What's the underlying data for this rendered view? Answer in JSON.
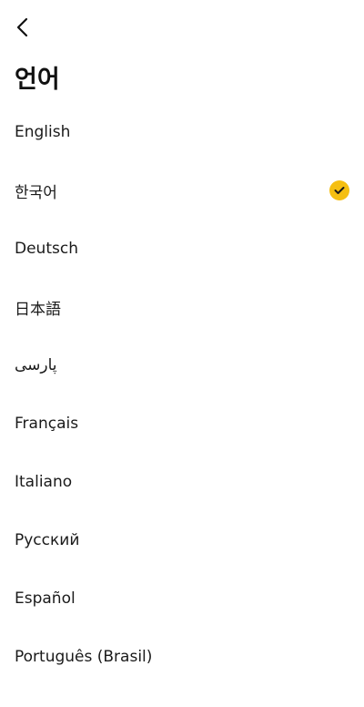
{
  "header": {
    "back_icon": "chevron-left-icon"
  },
  "page": {
    "title": "언어"
  },
  "languages": [
    {
      "label": "English",
      "selected": false
    },
    {
      "label": "한국어",
      "selected": true
    },
    {
      "label": "Deutsch",
      "selected": false
    },
    {
      "label": "日本語",
      "selected": false
    },
    {
      "label": "پارسی",
      "selected": false
    },
    {
      "label": "Français",
      "selected": false
    },
    {
      "label": "Italiano",
      "selected": false
    },
    {
      "label": "Русский",
      "selected": false
    },
    {
      "label": "Español",
      "selected": false
    },
    {
      "label": "Português (Brasil)",
      "selected": false
    }
  ],
  "colors": {
    "accent": "#f5bf12",
    "text": "#111111",
    "background": "#ffffff"
  },
  "selected_icon": "check-icon"
}
